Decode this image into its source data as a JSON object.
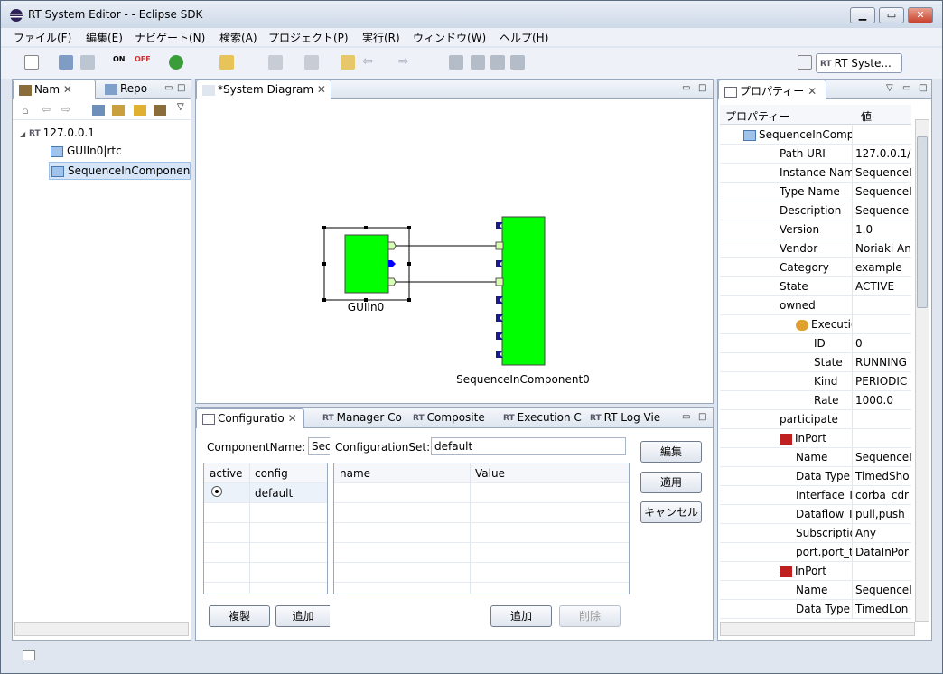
{
  "window": {
    "title": "RT System Editor -  - Eclipse SDK"
  },
  "menu": [
    "ファイル(F)",
    "編集(E)",
    "ナビゲート(N)",
    "検索(A)",
    "プロジェクト(P)",
    "実行(R)",
    "ウィンドウ(W)",
    "ヘルプ(H)"
  ],
  "perspective": {
    "label": "RT Syste..."
  },
  "left_panel": {
    "tabs": [
      "Nam",
      "Repo"
    ],
    "tree": {
      "root": "127.0.0.1",
      "children": [
        "GUIIn0|rtc",
        "SequenceInComponent"
      ]
    }
  },
  "editor": {
    "tab": "*System Diagram",
    "components": [
      {
        "name": "GUIIn0"
      },
      {
        "name": "SequenceInComponent0"
      }
    ]
  },
  "bottom": {
    "tabs": [
      "Configuratio",
      "Manager Co",
      "Composite",
      "Execution C",
      "RT Log Vie"
    ],
    "component_label": "ComponentName:",
    "component_value": "Seq",
    "configset_label": "ConfigurationSet:",
    "configset_value": "default",
    "left_headers": [
      "active",
      "config"
    ],
    "left_rows": [
      {
        "config": "default"
      }
    ],
    "right_headers": [
      "name",
      "Value"
    ],
    "buttons": {
      "edit": "編集",
      "apply": "適用",
      "cancel": "キャンセル",
      "copy": "複製",
      "add_left": "追加",
      "add_right": "追加",
      "delete": "削除"
    }
  },
  "properties": {
    "tab": "プロパティー",
    "headers": [
      "プロパティー",
      "値"
    ],
    "rows": [
      {
        "k": "SequenceInCompo",
        "v": ""
      },
      {
        "k": "Path URI",
        "v": "127.0.0.1/"
      },
      {
        "k": "Instance Name",
        "v": "SequenceI"
      },
      {
        "k": "Type Name",
        "v": "SequenceI"
      },
      {
        "k": "Description",
        "v": "Sequence"
      },
      {
        "k": "Version",
        "v": "1.0"
      },
      {
        "k": "Vendor",
        "v": "Noriaki An"
      },
      {
        "k": "Category",
        "v": "example"
      },
      {
        "k": "State",
        "v": "ACTIVE"
      },
      {
        "k": "owned",
        "v": ""
      },
      {
        "k": "ExecutionCo",
        "v": ""
      },
      {
        "k": "ID",
        "v": "0"
      },
      {
        "k": "State",
        "v": "RUNNING"
      },
      {
        "k": "Kind",
        "v": "PERIODIC"
      },
      {
        "k": "Rate",
        "v": "1000.0"
      },
      {
        "k": "participate",
        "v": ""
      },
      {
        "k": "InPort",
        "v": ""
      },
      {
        "k": "Name",
        "v": "SequenceI"
      },
      {
        "k": "Data Type",
        "v": "TimedSho"
      },
      {
        "k": "Interface Ty",
        "v": "corba_cdr"
      },
      {
        "k": "Dataflow Ty",
        "v": "pull,push"
      },
      {
        "k": "Subscriptio",
        "v": "Any"
      },
      {
        "k": "port.port_ty",
        "v": "DataInPor"
      },
      {
        "k": "InPort",
        "v": ""
      },
      {
        "k": "Name",
        "v": "SequenceI"
      },
      {
        "k": "Data Type",
        "v": "TimedLon"
      }
    ]
  }
}
